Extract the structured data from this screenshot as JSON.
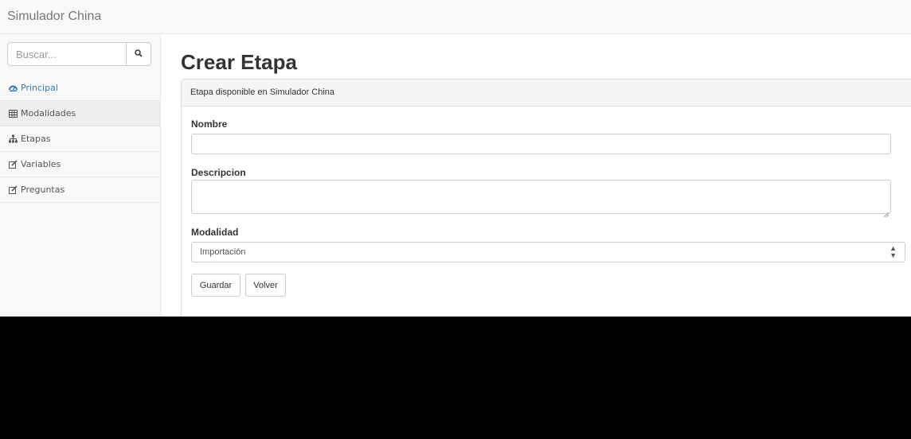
{
  "navbar": {
    "brand": "Simulador China"
  },
  "sidebar": {
    "search": {
      "placeholder": "Buscar..."
    },
    "items": [
      {
        "label": "Principal",
        "icon": "dashboard-icon"
      },
      {
        "label": "Modalidades",
        "icon": "table-icon"
      },
      {
        "label": "Etapas",
        "icon": "sitemap-icon"
      },
      {
        "label": "Variables",
        "icon": "edit-icon"
      },
      {
        "label": "Preguntas",
        "icon": "edit-icon"
      }
    ]
  },
  "main": {
    "title": "Crear Etapa",
    "panel": {
      "heading": "Etapa disponible en Simulador China",
      "nombre_label": "Nombre",
      "nombre_value": "",
      "descripcion_label": "Descripcion",
      "descripcion_value": "",
      "modalidad_label": "Modalidad",
      "modalidad_selected": "Importación",
      "save_label": "Guardar",
      "back_label": "Volver"
    }
  },
  "colors": {
    "link": "#337ab7",
    "navbar_bg": "#f8f8f8",
    "border": "#dddddd"
  }
}
